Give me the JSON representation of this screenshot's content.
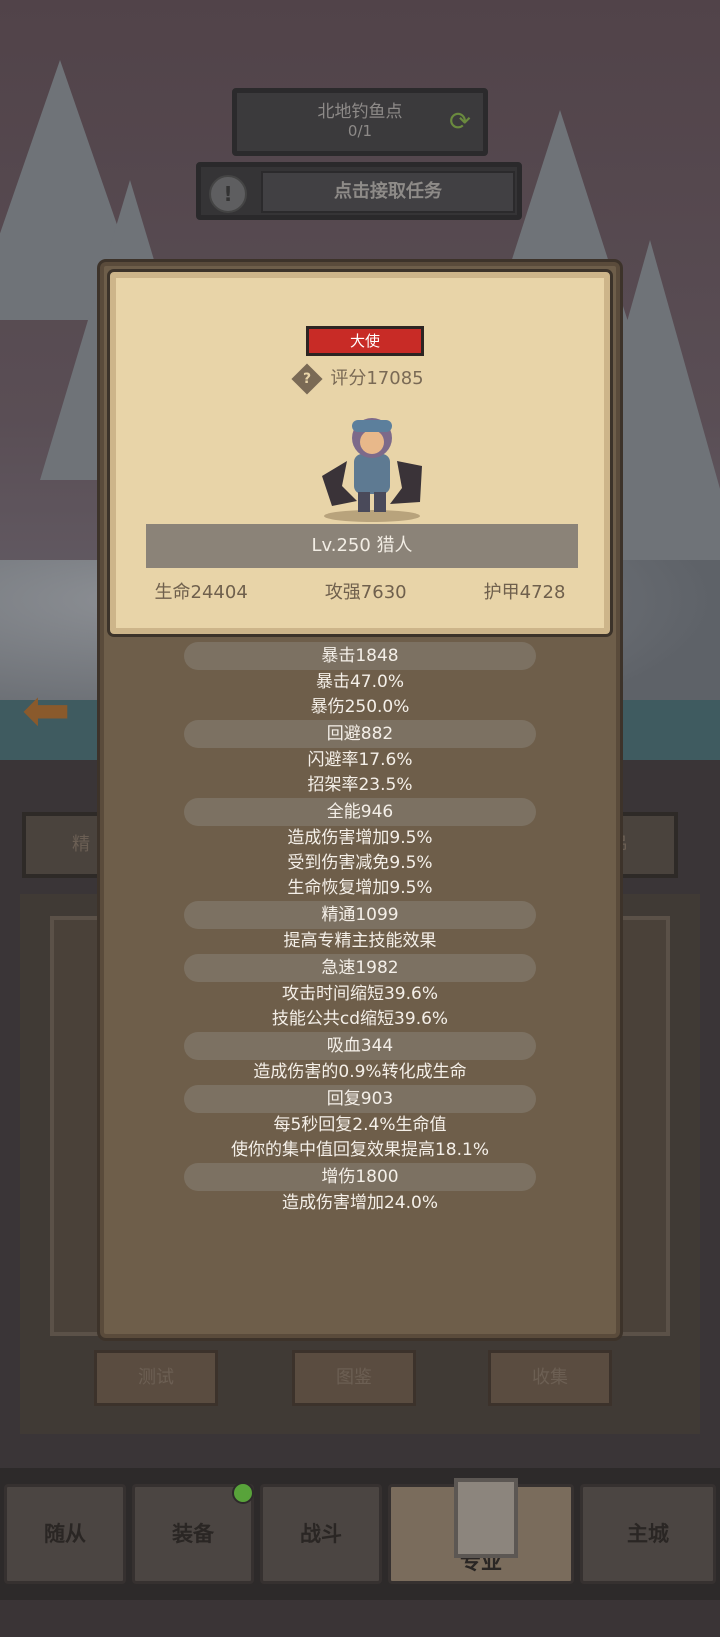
{
  "quest": {
    "title": "北地钓鱼点",
    "progress": "0/1",
    "accept_label": "点击接取任务"
  },
  "background": {
    "tab_left_text": "精",
    "tab_right_text": "吊",
    "buttons": [
      "测试",
      "图鉴",
      "收集"
    ]
  },
  "hero_card": {
    "rank": "大使",
    "score": "评分17085",
    "level_name": "Lv.250 猎人",
    "stats": [
      "生命24404",
      "攻强7630",
      "护甲4728"
    ]
  },
  "attributes": [
    {
      "name": "暴击1848",
      "lines": [
        "暴击47.0%",
        "暴伤250.0%"
      ]
    },
    {
      "name": "回避882",
      "lines": [
        "闪避率17.6%",
        "招架率23.5%"
      ]
    },
    {
      "name": "全能946",
      "lines": [
        "造成伤害增加9.5%",
        "受到伤害减免9.5%",
        "生命恢复增加9.5%"
      ]
    },
    {
      "name": "精通1099",
      "lines": [
        "提高专精主技能效果"
      ]
    },
    {
      "name": "急速1982",
      "lines": [
        "攻击时间缩短39.6%",
        "技能公共cd缩短39.6%"
      ]
    },
    {
      "name": "吸血344",
      "lines": [
        "造成伤害的0.9%转化成生命"
      ]
    },
    {
      "name": "回复903",
      "lines": [
        "每5秒回复2.4%生命值",
        "使你的集中值回复效果提高18.1%"
      ]
    },
    {
      "name": "增伤1800",
      "lines": [
        "造成伤害增加24.0%"
      ]
    }
  ],
  "nav": [
    {
      "label": "随从"
    },
    {
      "label": "装备"
    },
    {
      "label": "战斗"
    },
    {
      "label": "专业"
    },
    {
      "label": "主城"
    }
  ]
}
